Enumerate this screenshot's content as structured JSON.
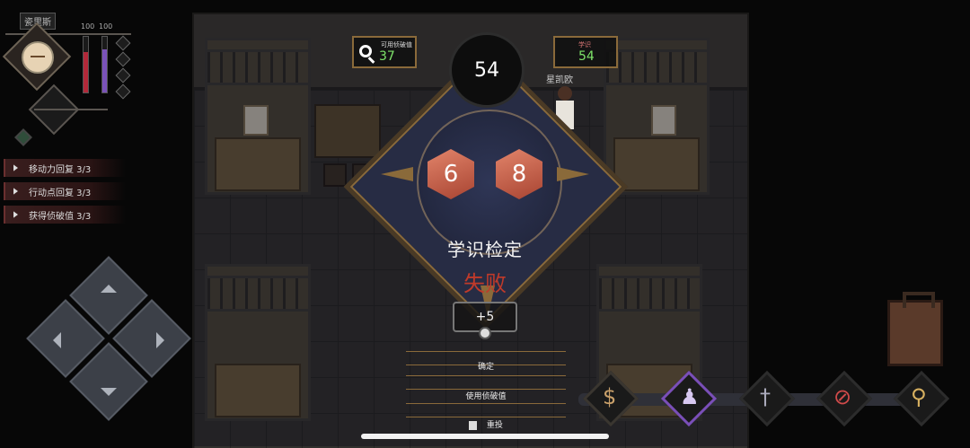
{
  "hud": {
    "player_name": "瓷里斯",
    "stat_a": "100",
    "stat_b": "100",
    "bars": {
      "red_level": 0.72,
      "purple_level": 0.78
    },
    "status_items": [
      {
        "label": "移动力回复 3/3"
      },
      {
        "label": "行动点回复 3/3"
      },
      {
        "label": "获得侦破值 3/3"
      }
    ]
  },
  "info": {
    "clue": {
      "label": "可用侦破值",
      "value": "37"
    },
    "knowledge": {
      "label": "学识",
      "value": "54"
    }
  },
  "npc_name": "星凯欧",
  "check": {
    "target": "54",
    "die_1": "6",
    "die_2": "8",
    "title": "学识检定",
    "result": "失败",
    "bonus": "+5",
    "options": [
      {
        "label": "确定"
      },
      {
        "label": "使用侦破值"
      },
      {
        "label": "重投"
      }
    ]
  },
  "actions": [
    {
      "icon": "dollar-icon",
      "symbol": "$"
    },
    {
      "icon": "person-icon",
      "symbol": "♟"
    },
    {
      "icon": "sword-icon",
      "symbol": "†"
    },
    {
      "icon": "forbidden-icon",
      "symbol": "⊘"
    },
    {
      "icon": "magnifier-icon",
      "symbol": "⚲"
    }
  ],
  "colors": {
    "fail_red": "#c03a2a",
    "value_green": "#7ee36a",
    "gold_border": "#8a6a3a",
    "die_red": "#d06a52"
  }
}
